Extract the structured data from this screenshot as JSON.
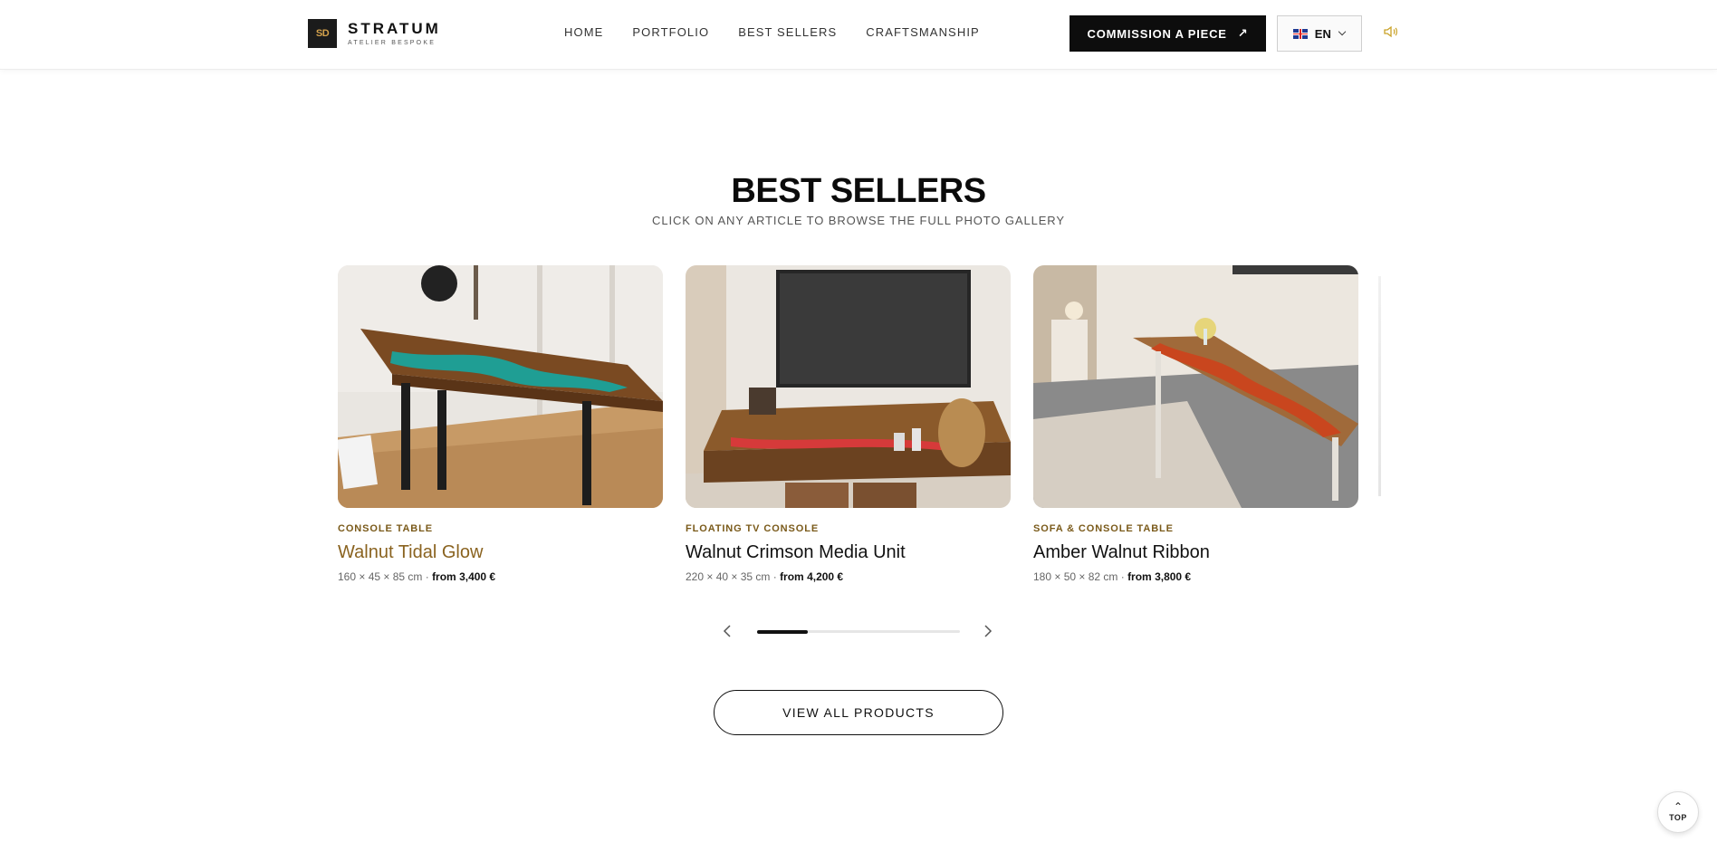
{
  "header": {
    "logo_mark": "SD",
    "brand_name": "STRATUM",
    "brand_sub": "ATELIER BESPOKE",
    "nav": [
      "HOME",
      "PORTFOLIO",
      "BEST SELLERS",
      "CRAFTSMANSHIP"
    ],
    "cta_label": "COMMISSION A PIECE",
    "lang_label": "EN"
  },
  "section": {
    "title": "BEST SELLERS",
    "subtitle": "CLICK ON ANY ARTICLE TO BROWSE THE FULL PHOTO GALLERY"
  },
  "products": [
    {
      "category": "CONSOLE TABLE",
      "name": "Walnut Tidal Glow",
      "dims": "160 × 45 × 85 cm · ",
      "price": "from 3,400 €",
      "resin_color": "#1f9e94"
    },
    {
      "category": "FLOATING TV CONSOLE",
      "name": "Walnut Crimson Media Unit",
      "dims": "220 × 40 × 35 cm · ",
      "price": "from 4,200 €",
      "resin_color": "#d63a3a"
    },
    {
      "category": "SOFA & CONSOLE TABLE",
      "name": "Amber Walnut Ribbon",
      "dims": "180 × 50 × 82 cm · ",
      "price": "from 3,800 €",
      "resin_color": "#c9461e"
    }
  ],
  "carousel": {
    "progress_fraction": 0.25
  },
  "view_all_label": "VIEW ALL PRODUCTS",
  "top_label": "TOP",
  "colors": {
    "accent_gold": "#c9a227",
    "category_brown": "#7a5a1a",
    "dark": "#0d0d0d"
  }
}
